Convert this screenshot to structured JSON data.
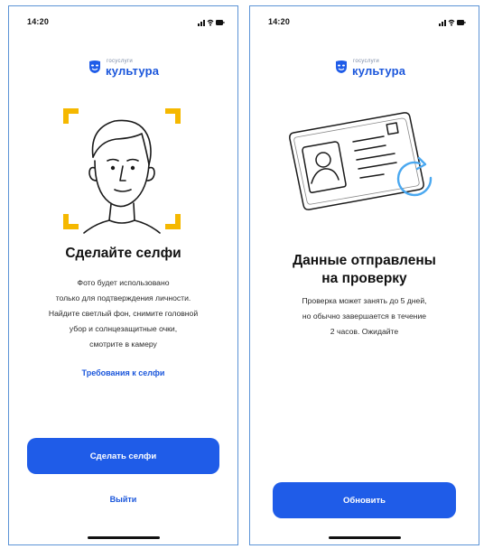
{
  "screens": {
    "left": {
      "status": {
        "time": "14:20"
      },
      "logo": {
        "small": "госуслуги",
        "big": "культура"
      },
      "title": "Сделайте селфи",
      "body_lines": [
        "Фото будет использовано",
        "только для подтверждения личности.",
        "Найдите светлый фон, снимите головной",
        "убор и солнцезащитные очки,",
        "смотрите в камеру"
      ],
      "requirements_link": "Требования к селфи",
      "primary_button": "Сделать селфи",
      "secondary_link": "Выйти"
    },
    "right": {
      "status": {
        "time": "14:20"
      },
      "logo": {
        "small": "госуслуги",
        "big": "культура"
      },
      "title_lines": [
        "Данные отправлены",
        "на проверку"
      ],
      "body_lines": [
        "Проверка может занять до 5 дней,",
        "но обычно завершается в течение",
        "2 часов. Ожидайте"
      ],
      "primary_button": "Обновить"
    }
  },
  "colors": {
    "accent": "#1f5ce8",
    "link": "#1a56db",
    "frame_corners": "#f5b800",
    "refresh_arrow": "#4aa8f0",
    "device_border": "#5b93d6"
  },
  "icons": {
    "mask_logo": "theater-mask-icon",
    "signal": "cellular-signal-icon",
    "wifi": "wifi-icon",
    "battery": "battery-icon",
    "face": "face-outline-icon",
    "id_card": "id-card-icon",
    "refresh": "refresh-arrow-icon"
  }
}
